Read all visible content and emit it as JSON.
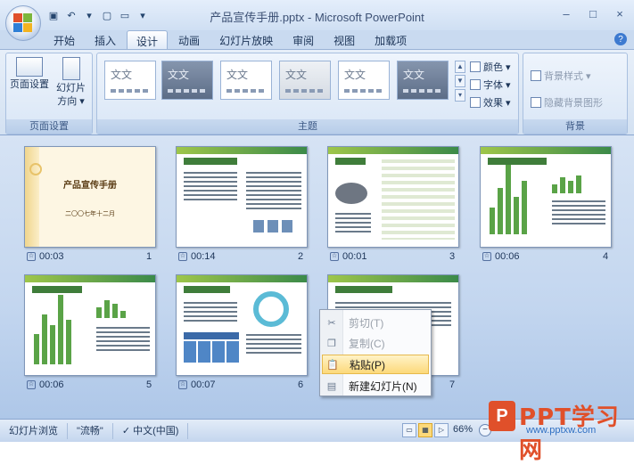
{
  "window": {
    "title": "产品宣传手册.pptx - Microsoft PowerPoint",
    "controls": [
      "–",
      "□",
      "×"
    ]
  },
  "tabs": [
    "开始",
    "插入",
    "设计",
    "动画",
    "幻灯片放映",
    "审阅",
    "视图",
    "加载项"
  ],
  "active_tab": "设计",
  "ribbon": {
    "page_setup": {
      "page_setup_label": "页面设置",
      "orientation_label_1": "幻灯片",
      "orientation_label_2": "方向 ▾",
      "group_label": "页面设置"
    },
    "themes": {
      "tile_text": "文文",
      "group_label": "主题",
      "colors_label": "颜色 ▾",
      "fonts_label": "字体 ▾",
      "effects_label": "效果 ▾"
    },
    "background": {
      "styles_label": "背景样式 ▾",
      "hide_graphics_label": "隐藏背景图形",
      "group_label": "背景"
    }
  },
  "slides": [
    {
      "number": "1",
      "timing": "00:03",
      "title": "产品宣传手册",
      "subtitle": "二〇〇七年十二月"
    },
    {
      "number": "2",
      "timing": "00:14"
    },
    {
      "number": "3",
      "timing": "00:01"
    },
    {
      "number": "4",
      "timing": "00:06"
    },
    {
      "number": "5",
      "timing": "00:06"
    },
    {
      "number": "6",
      "timing": "00:07"
    },
    {
      "number": "7",
      "timing": ""
    }
  ],
  "context_menu": {
    "cut": "剪切(T)",
    "copy": "复制(C)",
    "paste": "粘贴(P)",
    "new_slide": "新建幻灯片(N)"
  },
  "statusbar": {
    "view_name": "幻灯片浏览",
    "theme_name": "\"流畅\"",
    "language": "中文(中国)",
    "zoom": "66%"
  },
  "watermark": {
    "brand": "PPT学习网",
    "url": "www.pptxw.com"
  }
}
